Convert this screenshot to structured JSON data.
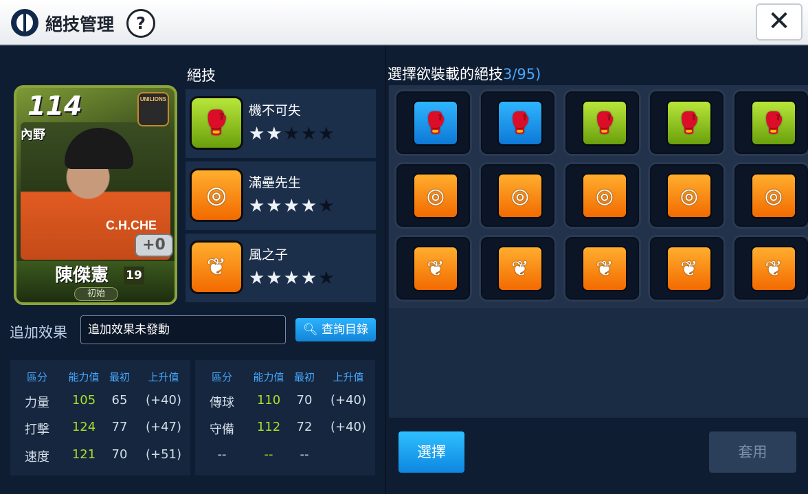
{
  "header": {
    "title": "絕技管理",
    "help_label": "?",
    "close_label": "✕"
  },
  "player": {
    "rating": "114",
    "position": "內野",
    "team_logo": "UNILIONS",
    "plus_level": "+0",
    "name": "陳傑憲",
    "number": "19",
    "grade": "初始",
    "jersey_text": "C.H.CHE"
  },
  "skills_section": {
    "title": "絕技",
    "items": [
      {
        "name": "機不可失",
        "icon": "boxing-glove-icon",
        "color": "#8cc41a",
        "stars": 2,
        "max_stars": 5
      },
      {
        "name": "滿壘先生",
        "icon": "target-icon",
        "color": "#f58a10",
        "stars": 4,
        "max_stars": 5
      },
      {
        "name": "風之子",
        "icon": "wing-icon",
        "color": "#f58a10",
        "stars": 4,
        "max_stars": 5
      }
    ]
  },
  "bonus": {
    "label": "追加效果",
    "value": "追加效果未發動",
    "catalog_button": "查詢目錄"
  },
  "stats_left": {
    "headers": [
      "區分",
      "能力值",
      "最初",
      "上升值"
    ],
    "rows": [
      [
        "力量",
        "105",
        "65",
        "(+40)"
      ],
      [
        "打擊",
        "124",
        "77",
        "(+47)"
      ],
      [
        "速度",
        "121",
        "70",
        "(+51)"
      ]
    ]
  },
  "stats_right": {
    "headers": [
      "區分",
      "能力值",
      "最初",
      "上升值"
    ],
    "rows": [
      [
        "傳球",
        "110",
        "70",
        "(+40)"
      ],
      [
        "守備",
        "112",
        "72",
        "(+40)"
      ],
      [
        "--",
        "--",
        "--",
        ""
      ]
    ]
  },
  "selection": {
    "title": "選擇欲裝載的絕技",
    "count": "3/95)",
    "grid": [
      [
        "blue-glove",
        "blue-glove",
        "green-glove",
        "green-glove",
        "green-glove"
      ],
      [
        "orange-target",
        "orange-target",
        "orange-target",
        "orange-target",
        "orange-target"
      ],
      [
        "orange-wing",
        "orange-wing",
        "orange-wing",
        "orange-wing",
        "orange-wing"
      ]
    ],
    "select_button": "選擇",
    "apply_button": "套用"
  },
  "colors": {
    "accent_blue": "#1a9cf0",
    "stat_value_green": "#a8e02c",
    "panel_bg": "#0f1d33"
  }
}
